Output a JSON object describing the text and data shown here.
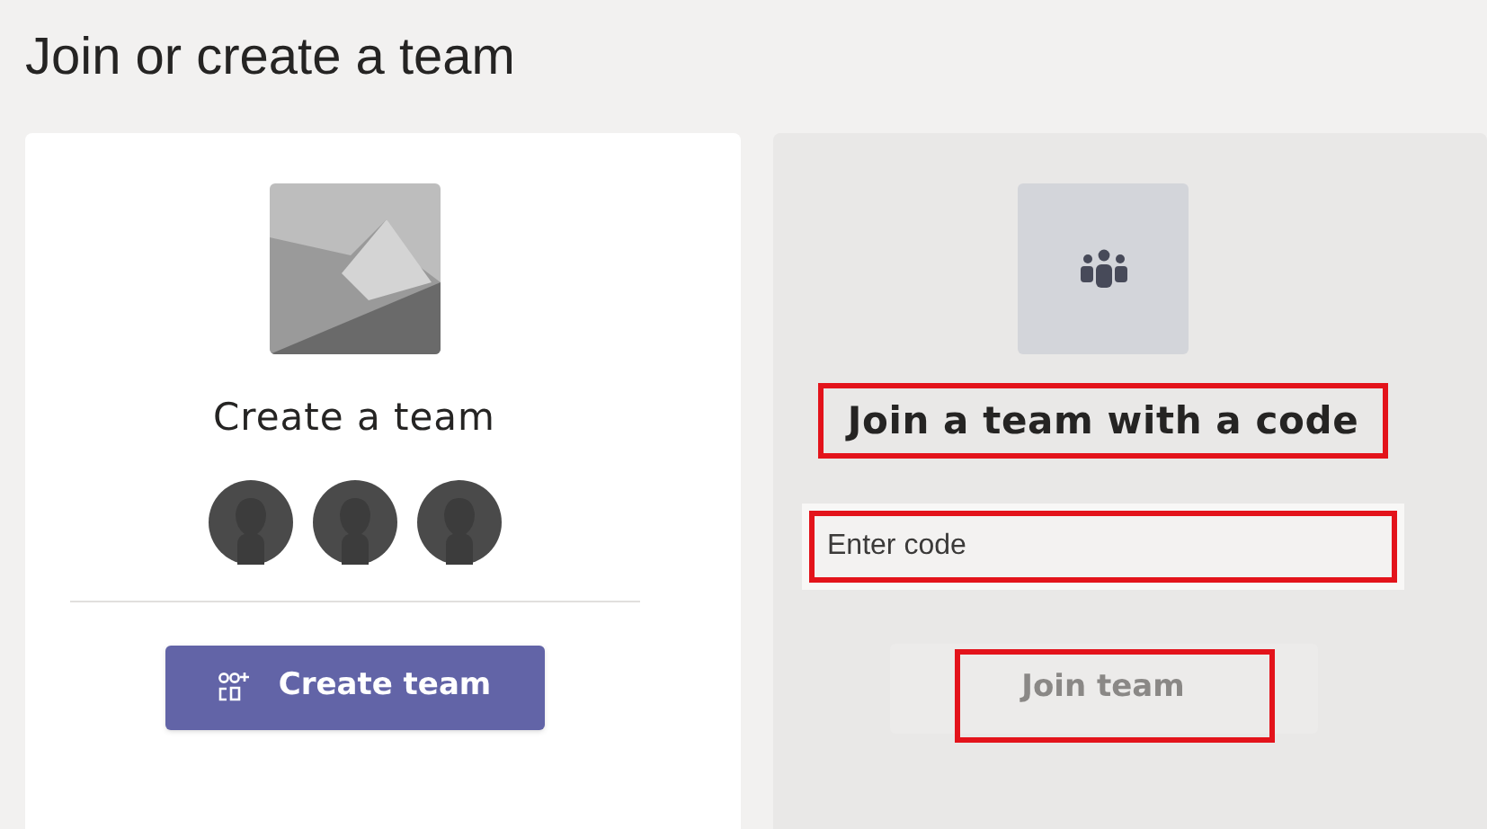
{
  "title": "Join or create a team",
  "create_card": {
    "heading": "Create a team",
    "button": "Create team"
  },
  "join_card": {
    "heading": {
      "text": "Join a team with a code",
      "highlighted": true
    },
    "code_field": {
      "placeholder": "Enter code",
      "highlighted": true
    },
    "button": {
      "label": "Join team",
      "disabled": true,
      "highlighted": true
    }
  }
}
